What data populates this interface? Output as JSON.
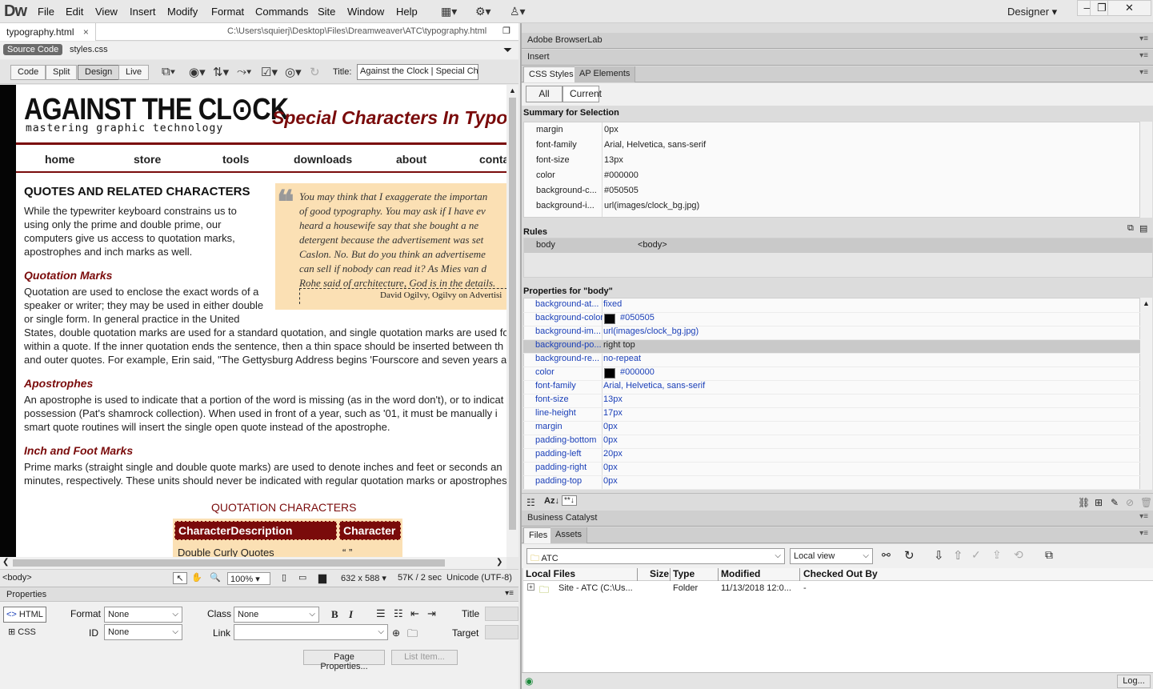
{
  "app": {
    "logo": "Dw",
    "menu": [
      "File",
      "Edit",
      "View",
      "Insert",
      "Modify",
      "Format",
      "Commands",
      "Site",
      "Window",
      "Help"
    ],
    "workspace": "Designer",
    "window_buttons": [
      "—",
      "❐",
      "✕"
    ]
  },
  "document": {
    "tab": "typography.html",
    "tab_close": "×",
    "path": "C:\\Users\\squierj\\Desktop\\Files\\Dreamweaver\\ATC\\typography.html",
    "source_code_label": "Source Code",
    "related_file": "styles.css",
    "views": [
      "Code",
      "Split",
      "Design",
      "Live"
    ],
    "title_label": "Title:",
    "title_value": "Against the Clock | Special Cha"
  },
  "page": {
    "logo_text": "AGAINST THE CL⊙CK",
    "logo_tagline": "mastering graphic technology",
    "site_title": "Special Characters In Typog",
    "nav": [
      "home",
      "store",
      "tools",
      "downloads",
      "about",
      "conta"
    ],
    "heading": "QUOTES AND RELATED CHARACTERS",
    "intro_lines": [
      "While the typewriter keyboard constrains us to",
      "using only the prime and double prime, our",
      "computers give us access to quotation marks,",
      "apostrophes and inch marks as well."
    ],
    "quote_lines": [
      "You may think that I exaggerate the importan",
      "of good typography. You may ask if I have ev",
      "heard a housewife say that she bought a ne",
      "detergent because the advertisement was set",
      "Caslon. No. But do you think an advertiseme",
      "can sell if nobody can read it? As Mies van d",
      "Rohe said of architecture, God is in the details."
    ],
    "quote_attribution": "David Ogilvy, Ogilvy on Advertisi",
    "h_quotation": "Quotation Marks",
    "quotation_lines": [
      "Quotation are used to enclose the exact words of a",
      "speaker or writer; they may be used in either double",
      "or single form. In general practice in the United",
      "States, double quotation marks are used for a standard quotation, and single quotation marks are used fo",
      "within a quote. If the inner quotation ends the sentence, then a thin space should be inserted between th",
      "and outer quotes. For example, Erin said, \"The Gettysburg Address begins 'Fourscore and seven years a"
    ],
    "h_apostrophes": "Apostrophes",
    "apostrophe_lines": [
      "An apostrophe is used to indicate that a portion of the word is missing (as in the word don't), or to indicat",
      "possession (Pat's shamrock collection). When used in front of a year, such as '01, it must be manually i",
      "smart quote routines will insert the single open quote instead of the apostrophe."
    ],
    "h_inch": "Inch and Foot Marks",
    "inch_lines": [
      "Prime marks (straight single and double quote marks) are used to denote inches and feet or seconds an",
      "minutes, respectively. These units should never be indicated with regular quotation marks or apostrophes"
    ],
    "table_caption": "QUOTATION CHARACTERS",
    "table_headers": [
      "CharacterDescription",
      "Character"
    ],
    "table_row": [
      "Double Curly Quotes",
      "“ ”"
    ]
  },
  "status": {
    "tag": "<body>",
    "zoom": "100%",
    "size": "632 x 588",
    "download": "57K / 2 sec",
    "encoding": "Unicode (UTF-8)"
  },
  "properties": {
    "title": "Properties",
    "html_label": "HTML",
    "css_label": "CSS",
    "format_label": "Format",
    "format_value": "None",
    "class_label": "Class",
    "class_value": "None",
    "id_label": "ID",
    "id_value": "None",
    "link_label": "Link",
    "link_value": "",
    "title_label": "Title",
    "target_label": "Target",
    "bold": "B",
    "italic": "I",
    "page_properties": "Page Properties...",
    "list_item": "List Item..."
  },
  "panels": {
    "browserlab": "Adobe BrowserLab",
    "insert": "Insert",
    "tabs": [
      "CSS Styles",
      "AP Elements"
    ],
    "mode_buttons": [
      "All",
      "Current"
    ],
    "summary_title": "Summary for Selection",
    "summary": [
      {
        "k": "margin",
        "v": "0px"
      },
      {
        "k": "font-family",
        "v": "Arial, Helvetica, sans-serif"
      },
      {
        "k": "font-size",
        "v": "13px"
      },
      {
        "k": "color",
        "v": "#000000"
      },
      {
        "k": "background-c...",
        "v": "#050505"
      },
      {
        "k": "background-i...",
        "v": "url(images/clock_bg.jpg)"
      }
    ],
    "rules_title": "Rules",
    "rule": {
      "k": "body",
      "v": "<body>"
    },
    "props_title": "Properties for \"body\"",
    "props": [
      {
        "k": "background-at...",
        "v": "fixed",
        "swatch": false
      },
      {
        "k": "background-color",
        "v": "#050505",
        "swatch": true
      },
      {
        "k": "background-im...",
        "v": "url(images/clock_bg.jpg)",
        "swatch": false
      },
      {
        "k": "background-po...",
        "v": "right top",
        "swatch": false
      },
      {
        "k": "background-re...",
        "v": "no-repeat",
        "swatch": false
      },
      {
        "k": "color",
        "v": "#000000",
        "swatch": true
      },
      {
        "k": "font-family",
        "v": "Arial, Helvetica, sans-serif",
        "swatch": false
      },
      {
        "k": "font-size",
        "v": "13px",
        "swatch": false
      },
      {
        "k": "line-height",
        "v": "17px",
        "swatch": false
      },
      {
        "k": "margin",
        "v": "0px",
        "swatch": false
      },
      {
        "k": "padding-bottom",
        "v": "0px",
        "swatch": false
      },
      {
        "k": "padding-left",
        "v": "20px",
        "swatch": false
      },
      {
        "k": "padding-right",
        "v": "0px",
        "swatch": false
      },
      {
        "k": "padding-top",
        "v": "0px",
        "swatch": false
      }
    ],
    "business_catalyst": "Business Catalyst",
    "files_tabs": [
      "Files",
      "Assets"
    ],
    "site_name": "ATC",
    "view_mode": "Local view",
    "file_columns": [
      "Local Files",
      "Size",
      "Type",
      "Modified",
      "Checked Out By"
    ],
    "file_row": {
      "name": "Site - ATC (C:\\Us...",
      "size": "",
      "type": "Folder",
      "modified": "11/13/2018 12:0...",
      "checked": "-"
    },
    "log_button": "Log..."
  },
  "colors": {
    "accent": "#7a0b0b",
    "quote_bg": "#fbe0b4",
    "link_blue": "#1a3fb8"
  }
}
